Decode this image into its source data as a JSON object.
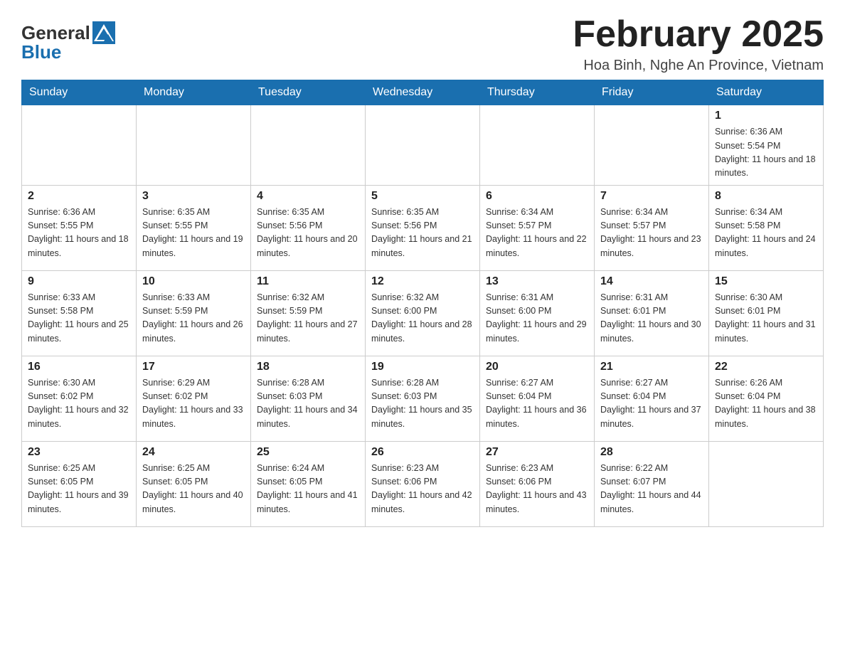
{
  "logo": {
    "general": "General",
    "blue": "Blue"
  },
  "header": {
    "title": "February 2025",
    "subtitle": "Hoa Binh, Nghe An Province, Vietnam"
  },
  "days_of_week": [
    "Sunday",
    "Monday",
    "Tuesday",
    "Wednesday",
    "Thursday",
    "Friday",
    "Saturday"
  ],
  "weeks": [
    [
      {
        "day": "",
        "info": ""
      },
      {
        "day": "",
        "info": ""
      },
      {
        "day": "",
        "info": ""
      },
      {
        "day": "",
        "info": ""
      },
      {
        "day": "",
        "info": ""
      },
      {
        "day": "",
        "info": ""
      },
      {
        "day": "1",
        "info": "Sunrise: 6:36 AM\nSunset: 5:54 PM\nDaylight: 11 hours and 18 minutes."
      }
    ],
    [
      {
        "day": "2",
        "info": "Sunrise: 6:36 AM\nSunset: 5:55 PM\nDaylight: 11 hours and 18 minutes."
      },
      {
        "day": "3",
        "info": "Sunrise: 6:35 AM\nSunset: 5:55 PM\nDaylight: 11 hours and 19 minutes."
      },
      {
        "day": "4",
        "info": "Sunrise: 6:35 AM\nSunset: 5:56 PM\nDaylight: 11 hours and 20 minutes."
      },
      {
        "day": "5",
        "info": "Sunrise: 6:35 AM\nSunset: 5:56 PM\nDaylight: 11 hours and 21 minutes."
      },
      {
        "day": "6",
        "info": "Sunrise: 6:34 AM\nSunset: 5:57 PM\nDaylight: 11 hours and 22 minutes."
      },
      {
        "day": "7",
        "info": "Sunrise: 6:34 AM\nSunset: 5:57 PM\nDaylight: 11 hours and 23 minutes."
      },
      {
        "day": "8",
        "info": "Sunrise: 6:34 AM\nSunset: 5:58 PM\nDaylight: 11 hours and 24 minutes."
      }
    ],
    [
      {
        "day": "9",
        "info": "Sunrise: 6:33 AM\nSunset: 5:58 PM\nDaylight: 11 hours and 25 minutes."
      },
      {
        "day": "10",
        "info": "Sunrise: 6:33 AM\nSunset: 5:59 PM\nDaylight: 11 hours and 26 minutes."
      },
      {
        "day": "11",
        "info": "Sunrise: 6:32 AM\nSunset: 5:59 PM\nDaylight: 11 hours and 27 minutes."
      },
      {
        "day": "12",
        "info": "Sunrise: 6:32 AM\nSunset: 6:00 PM\nDaylight: 11 hours and 28 minutes."
      },
      {
        "day": "13",
        "info": "Sunrise: 6:31 AM\nSunset: 6:00 PM\nDaylight: 11 hours and 29 minutes."
      },
      {
        "day": "14",
        "info": "Sunrise: 6:31 AM\nSunset: 6:01 PM\nDaylight: 11 hours and 30 minutes."
      },
      {
        "day": "15",
        "info": "Sunrise: 6:30 AM\nSunset: 6:01 PM\nDaylight: 11 hours and 31 minutes."
      }
    ],
    [
      {
        "day": "16",
        "info": "Sunrise: 6:30 AM\nSunset: 6:02 PM\nDaylight: 11 hours and 32 minutes."
      },
      {
        "day": "17",
        "info": "Sunrise: 6:29 AM\nSunset: 6:02 PM\nDaylight: 11 hours and 33 minutes."
      },
      {
        "day": "18",
        "info": "Sunrise: 6:28 AM\nSunset: 6:03 PM\nDaylight: 11 hours and 34 minutes."
      },
      {
        "day": "19",
        "info": "Sunrise: 6:28 AM\nSunset: 6:03 PM\nDaylight: 11 hours and 35 minutes."
      },
      {
        "day": "20",
        "info": "Sunrise: 6:27 AM\nSunset: 6:04 PM\nDaylight: 11 hours and 36 minutes."
      },
      {
        "day": "21",
        "info": "Sunrise: 6:27 AM\nSunset: 6:04 PM\nDaylight: 11 hours and 37 minutes."
      },
      {
        "day": "22",
        "info": "Sunrise: 6:26 AM\nSunset: 6:04 PM\nDaylight: 11 hours and 38 minutes."
      }
    ],
    [
      {
        "day": "23",
        "info": "Sunrise: 6:25 AM\nSunset: 6:05 PM\nDaylight: 11 hours and 39 minutes."
      },
      {
        "day": "24",
        "info": "Sunrise: 6:25 AM\nSunset: 6:05 PM\nDaylight: 11 hours and 40 minutes."
      },
      {
        "day": "25",
        "info": "Sunrise: 6:24 AM\nSunset: 6:05 PM\nDaylight: 11 hours and 41 minutes."
      },
      {
        "day": "26",
        "info": "Sunrise: 6:23 AM\nSunset: 6:06 PM\nDaylight: 11 hours and 42 minutes."
      },
      {
        "day": "27",
        "info": "Sunrise: 6:23 AM\nSunset: 6:06 PM\nDaylight: 11 hours and 43 minutes."
      },
      {
        "day": "28",
        "info": "Sunrise: 6:22 AM\nSunset: 6:07 PM\nDaylight: 11 hours and 44 minutes."
      },
      {
        "day": "",
        "info": ""
      }
    ]
  ]
}
